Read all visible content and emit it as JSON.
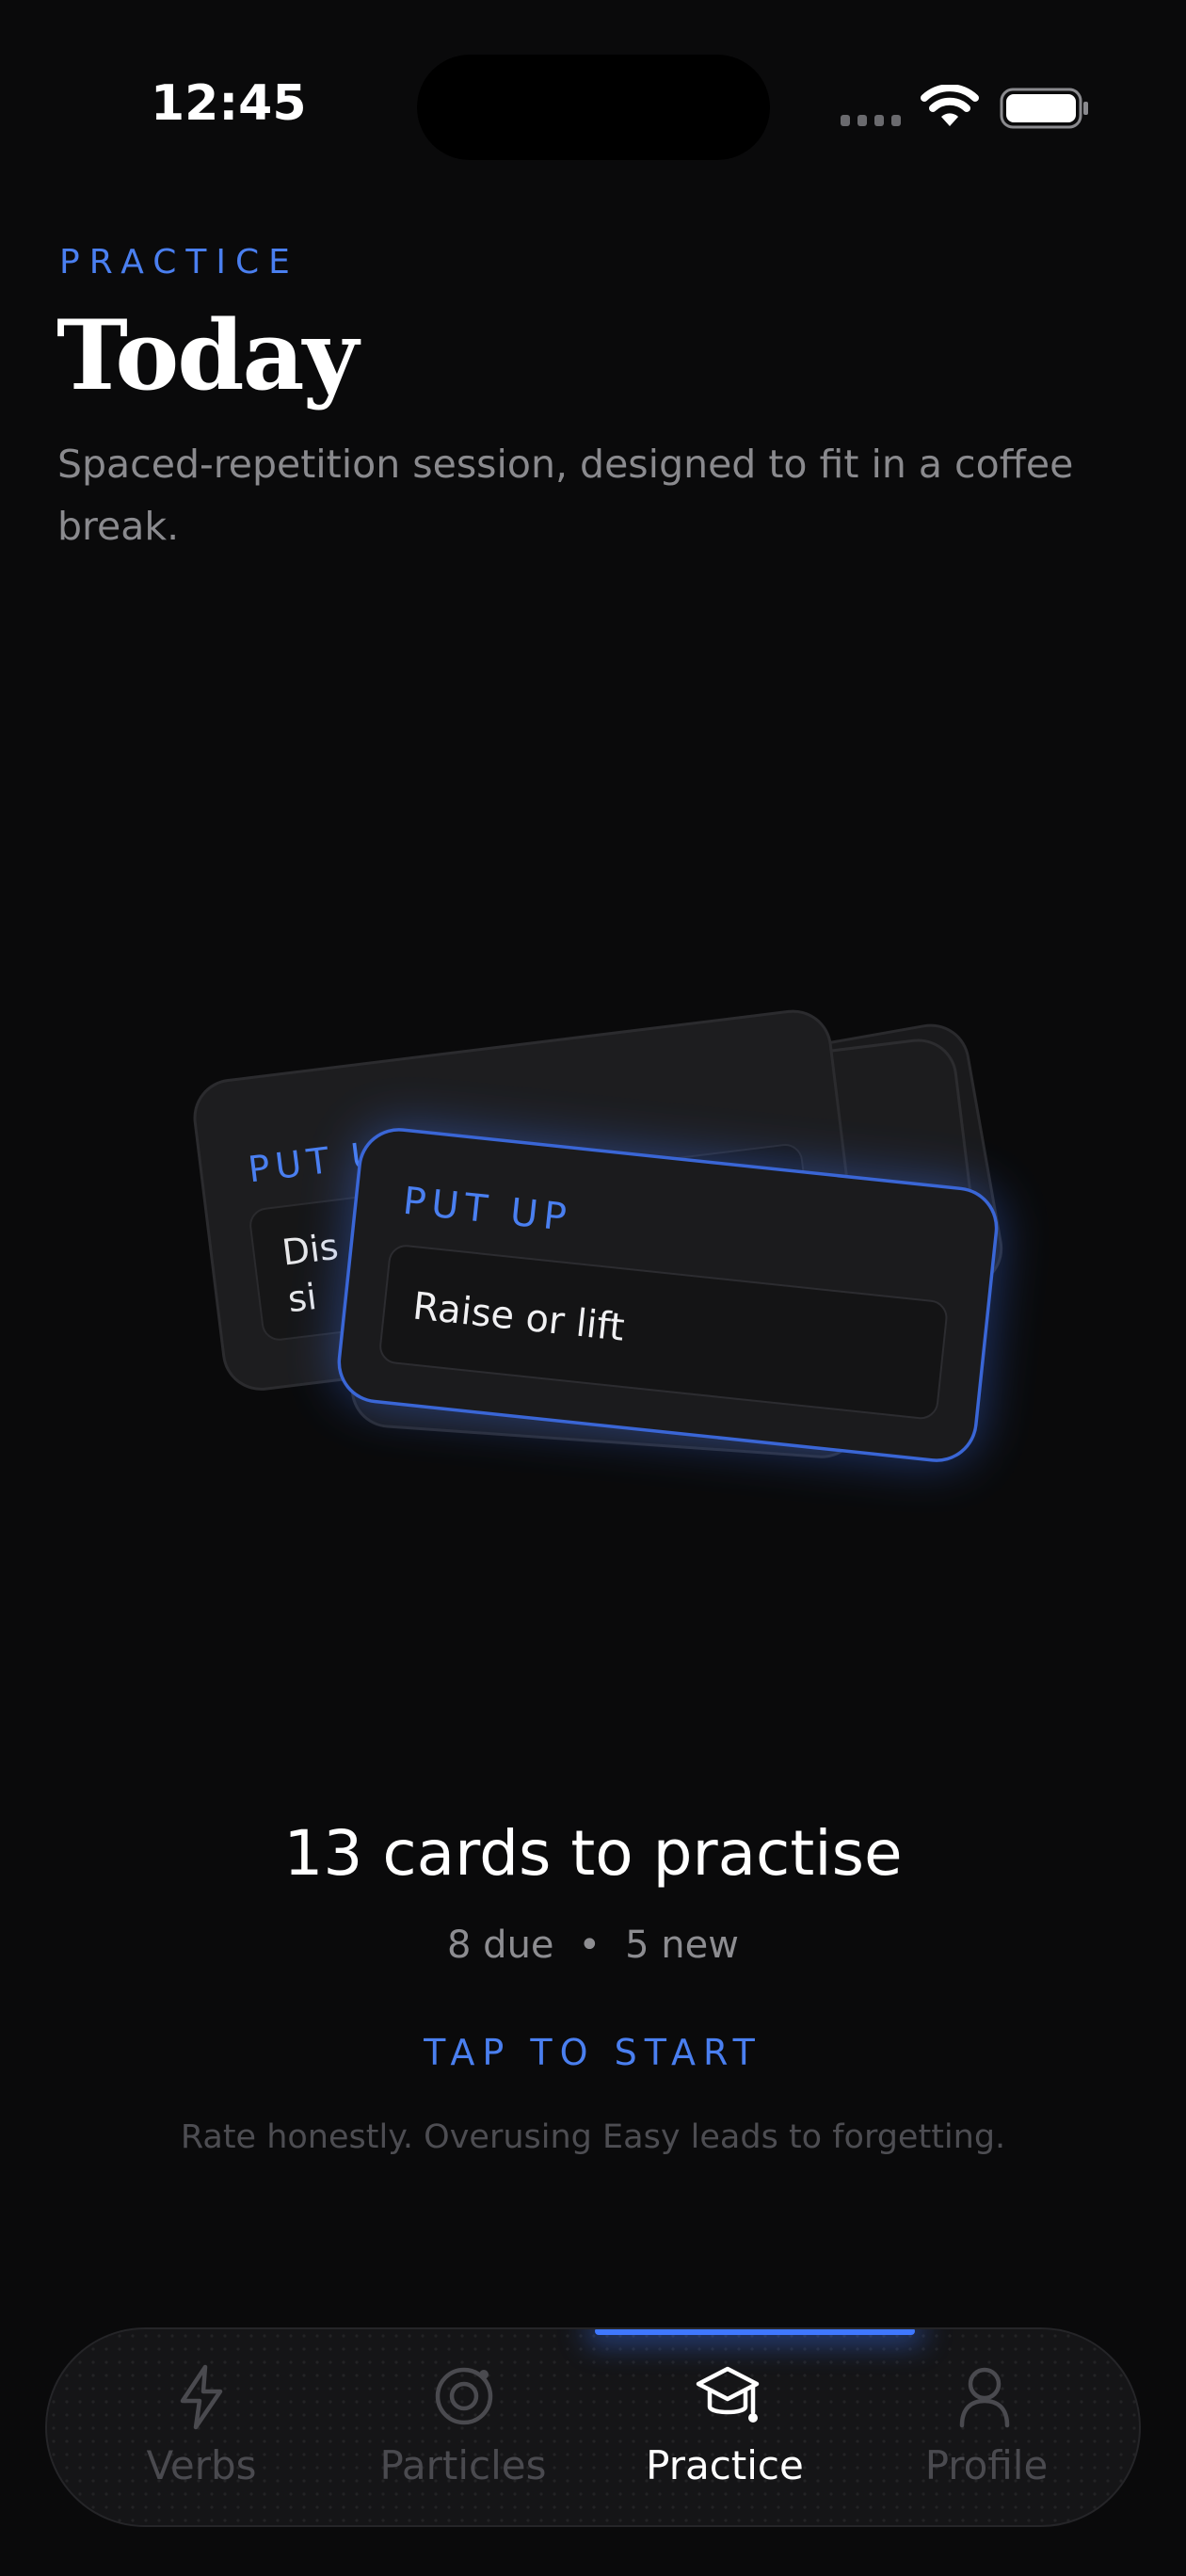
{
  "status_bar": {
    "time": "12:45"
  },
  "header": {
    "eyebrow": "PRACTICE",
    "title": "Today",
    "subtitle": "Spaced-repetition session, designed to fit in a coffee break."
  },
  "cards": {
    "front": {
      "verb": "PUT UP",
      "definition": "Raise or lift"
    },
    "back": {
      "verb": "PUT UP",
      "definition_partial_line1": "Dis",
      "definition_partial_line2": "si"
    }
  },
  "summary": {
    "title": "13 cards to practise",
    "due": "8 due",
    "separator": "•",
    "new": "5 new",
    "start": "TAP TO START",
    "hint": "Rate honestly. Overusing Easy leads to forgetting."
  },
  "tabs": [
    {
      "label": "Verbs",
      "icon": "lightning-icon",
      "active": false
    },
    {
      "label": "Particles",
      "icon": "target-icon",
      "active": false
    },
    {
      "label": "Practice",
      "icon": "graduation-cap-icon",
      "active": true
    },
    {
      "label": "Profile",
      "icon": "person-icon",
      "active": false
    }
  ],
  "colors": {
    "accent": "#4a7ff0",
    "background": "#0a0a0b",
    "muted": "#8a8a8e"
  }
}
